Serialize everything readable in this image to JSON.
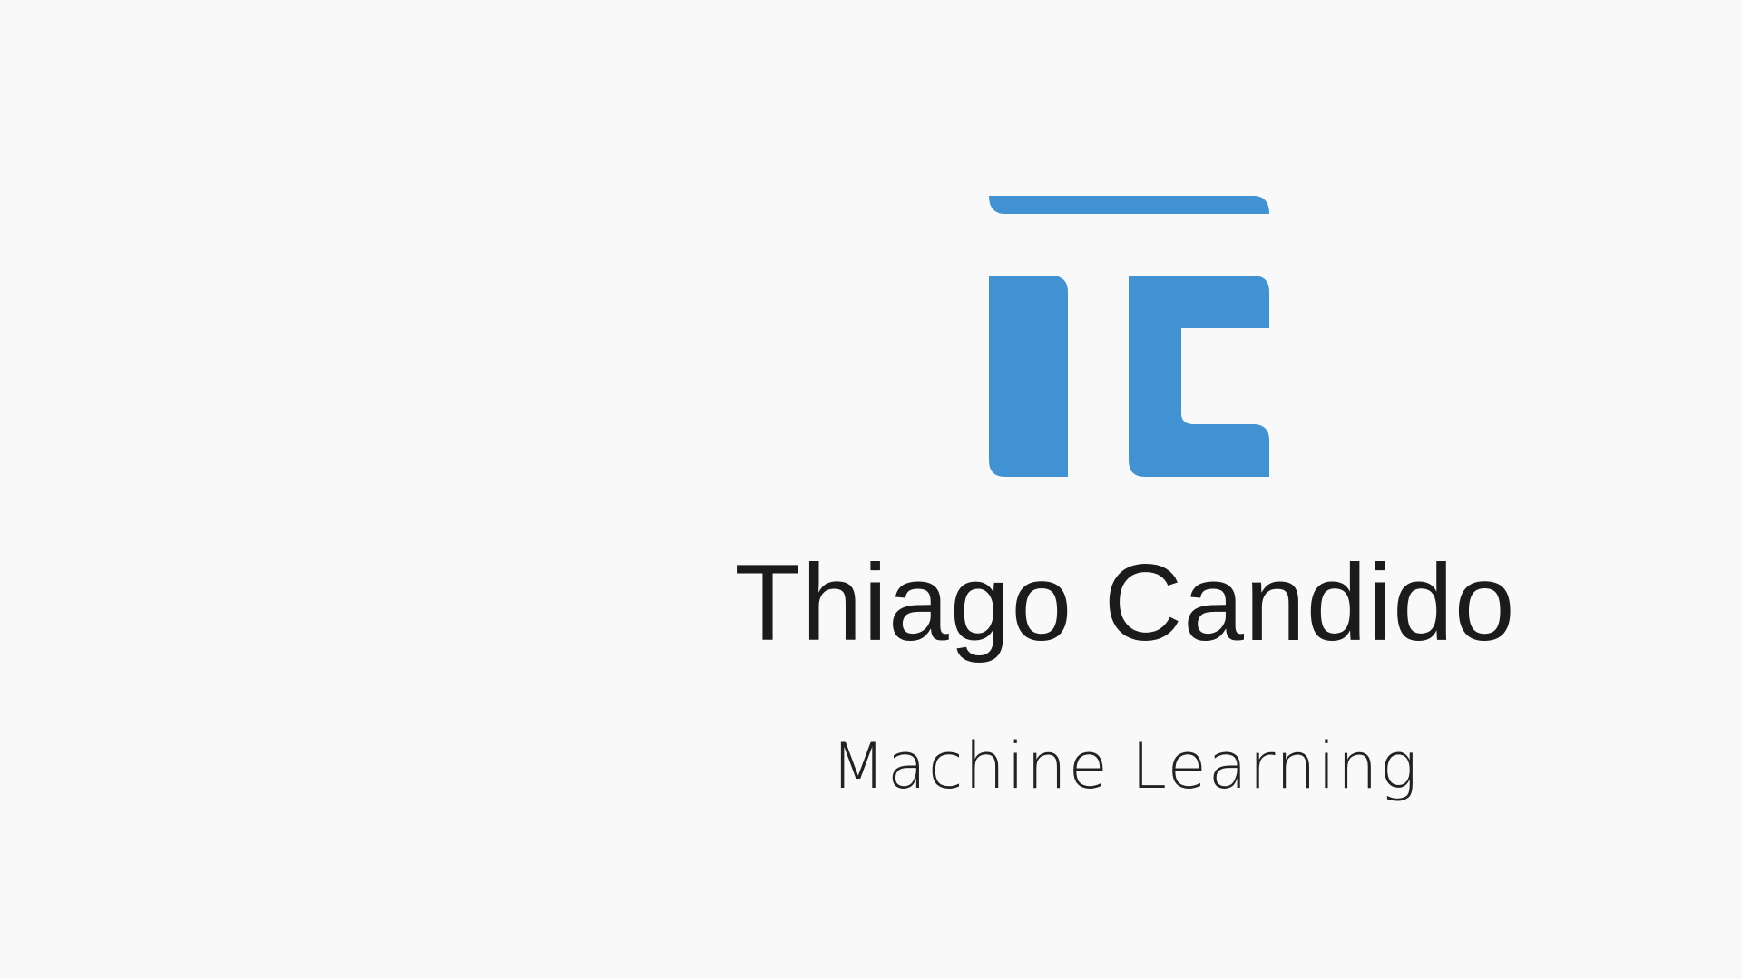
{
  "brand": {
    "logo_icon": "tc-monogram-logo-icon",
    "accent_color": "#4192d3",
    "name": "Thiago Candido",
    "tagline": "Machine Learning",
    "text_color": "#1b1b1b",
    "background_color": "#f9f9f9"
  }
}
